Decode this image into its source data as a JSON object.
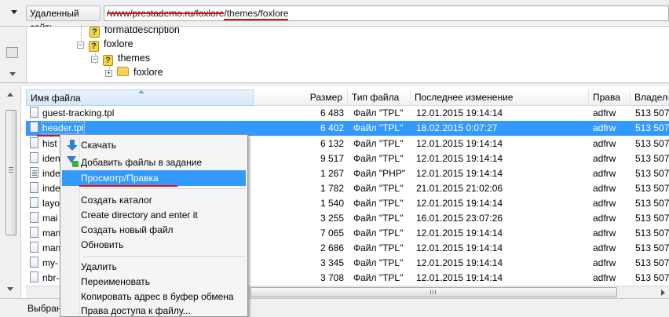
{
  "address": {
    "label": "Удаленный сайт:",
    "path_struck": "/www/prestademo.ru/foxlore",
    "path_rest": "/themes/",
    "path_last": "foxlore"
  },
  "tree": {
    "items": [
      {
        "label": "formatdescription",
        "icon": "question-folder-icon"
      },
      {
        "label": "foxlore",
        "icon": "question-folder-icon",
        "expander": "minus"
      },
      {
        "label": "themes",
        "icon": "question-folder-icon",
        "expander": "minus"
      },
      {
        "label": "foxlore",
        "icon": "folder-icon",
        "expander": "plus"
      }
    ]
  },
  "columns": {
    "name": "Имя файла",
    "size": "Размер",
    "type": "Тип файла",
    "modified": "Последнее изменение",
    "perms": "Права",
    "owner": "Владелец"
  },
  "files": [
    {
      "name": "guest-tracking.tpl",
      "size": "6 483",
      "type": "Файл \"TPL\"",
      "modified": "12.01.2015 19:14:14",
      "perms": "adfrw",
      "owner": "513 507"
    },
    {
      "name": "header.tpl",
      "size": "6 402",
      "type": "Файл \"TPL\"",
      "modified": "18.02.2015 0:07:27",
      "perms": "adfrw",
      "owner": "513 507"
    },
    {
      "name": "hist",
      "size": "6 132",
      "type": "Файл \"TPL\"",
      "modified": "12.01.2015 19:14:14",
      "perms": "adfrw",
      "owner": "513 507"
    },
    {
      "name": "iden",
      "size": "9 517",
      "type": "Файл \"TPL\"",
      "modified": "12.01.2015 19:14:14",
      "perms": "adfrw",
      "owner": "513 507"
    },
    {
      "name": "inde",
      "size": "1 267",
      "type": "Файл \"PHP\"",
      "modified": "12.01.2015 19:14:14",
      "perms": "adfrw",
      "owner": "513 507"
    },
    {
      "name": "inde",
      "size": "1 782",
      "type": "Файл \"TPL\"",
      "modified": "21.01.2015 21:02:06",
      "perms": "adfrw",
      "owner": "513 507"
    },
    {
      "name": "layo",
      "size": "1 540",
      "type": "Файл \"TPL\"",
      "modified": "12.01.2015 19:14:14",
      "perms": "adfrw",
      "owner": "513 507"
    },
    {
      "name": "mai",
      "size": "3 255",
      "type": "Файл \"TPL\"",
      "modified": "16.01.2015 23:07:26",
      "perms": "adfrw",
      "owner": "513 507"
    },
    {
      "name": "man",
      "size": "7 065",
      "type": "Файл \"TPL\"",
      "modified": "12.01.2015 19:14:14",
      "perms": "adfrw",
      "owner": "513 507"
    },
    {
      "name": "man",
      "size": "2 686",
      "type": "Файл \"TPL\"",
      "modified": "12.01.2015 19:14:14",
      "perms": "adfrw",
      "owner": "513 507"
    },
    {
      "name": "my-",
      "size": "3 345",
      "type": "Файл \"TPL\"",
      "modified": "12.01.2015 19:14:14",
      "perms": "adfrw",
      "owner": "513 507"
    },
    {
      "name": "nbr-",
      "size": "3 708",
      "type": "Файл \"TPL\"",
      "modified": "12.01.2015 19:14:14",
      "perms": "adfrw",
      "owner": "513 507"
    }
  ],
  "status": {
    "text": "Выбран"
  },
  "context_menu": {
    "download": "Скачать",
    "add_to_queue": "Добавить файлы в задание",
    "view_edit": "Просмотр/Правка",
    "create_dir": "Создать каталог",
    "create_dir_enter": "Create directory and enter it",
    "create_file": "Создать новый файл",
    "refresh": "Обновить",
    "delete": "Удалить",
    "rename": "Переименовать",
    "copy_url": "Копировать адрес в буфер обмена",
    "permissions": "Права доступа к файлу..."
  },
  "colors": {
    "selection": "#3399ff",
    "annotation": "#e01010"
  }
}
